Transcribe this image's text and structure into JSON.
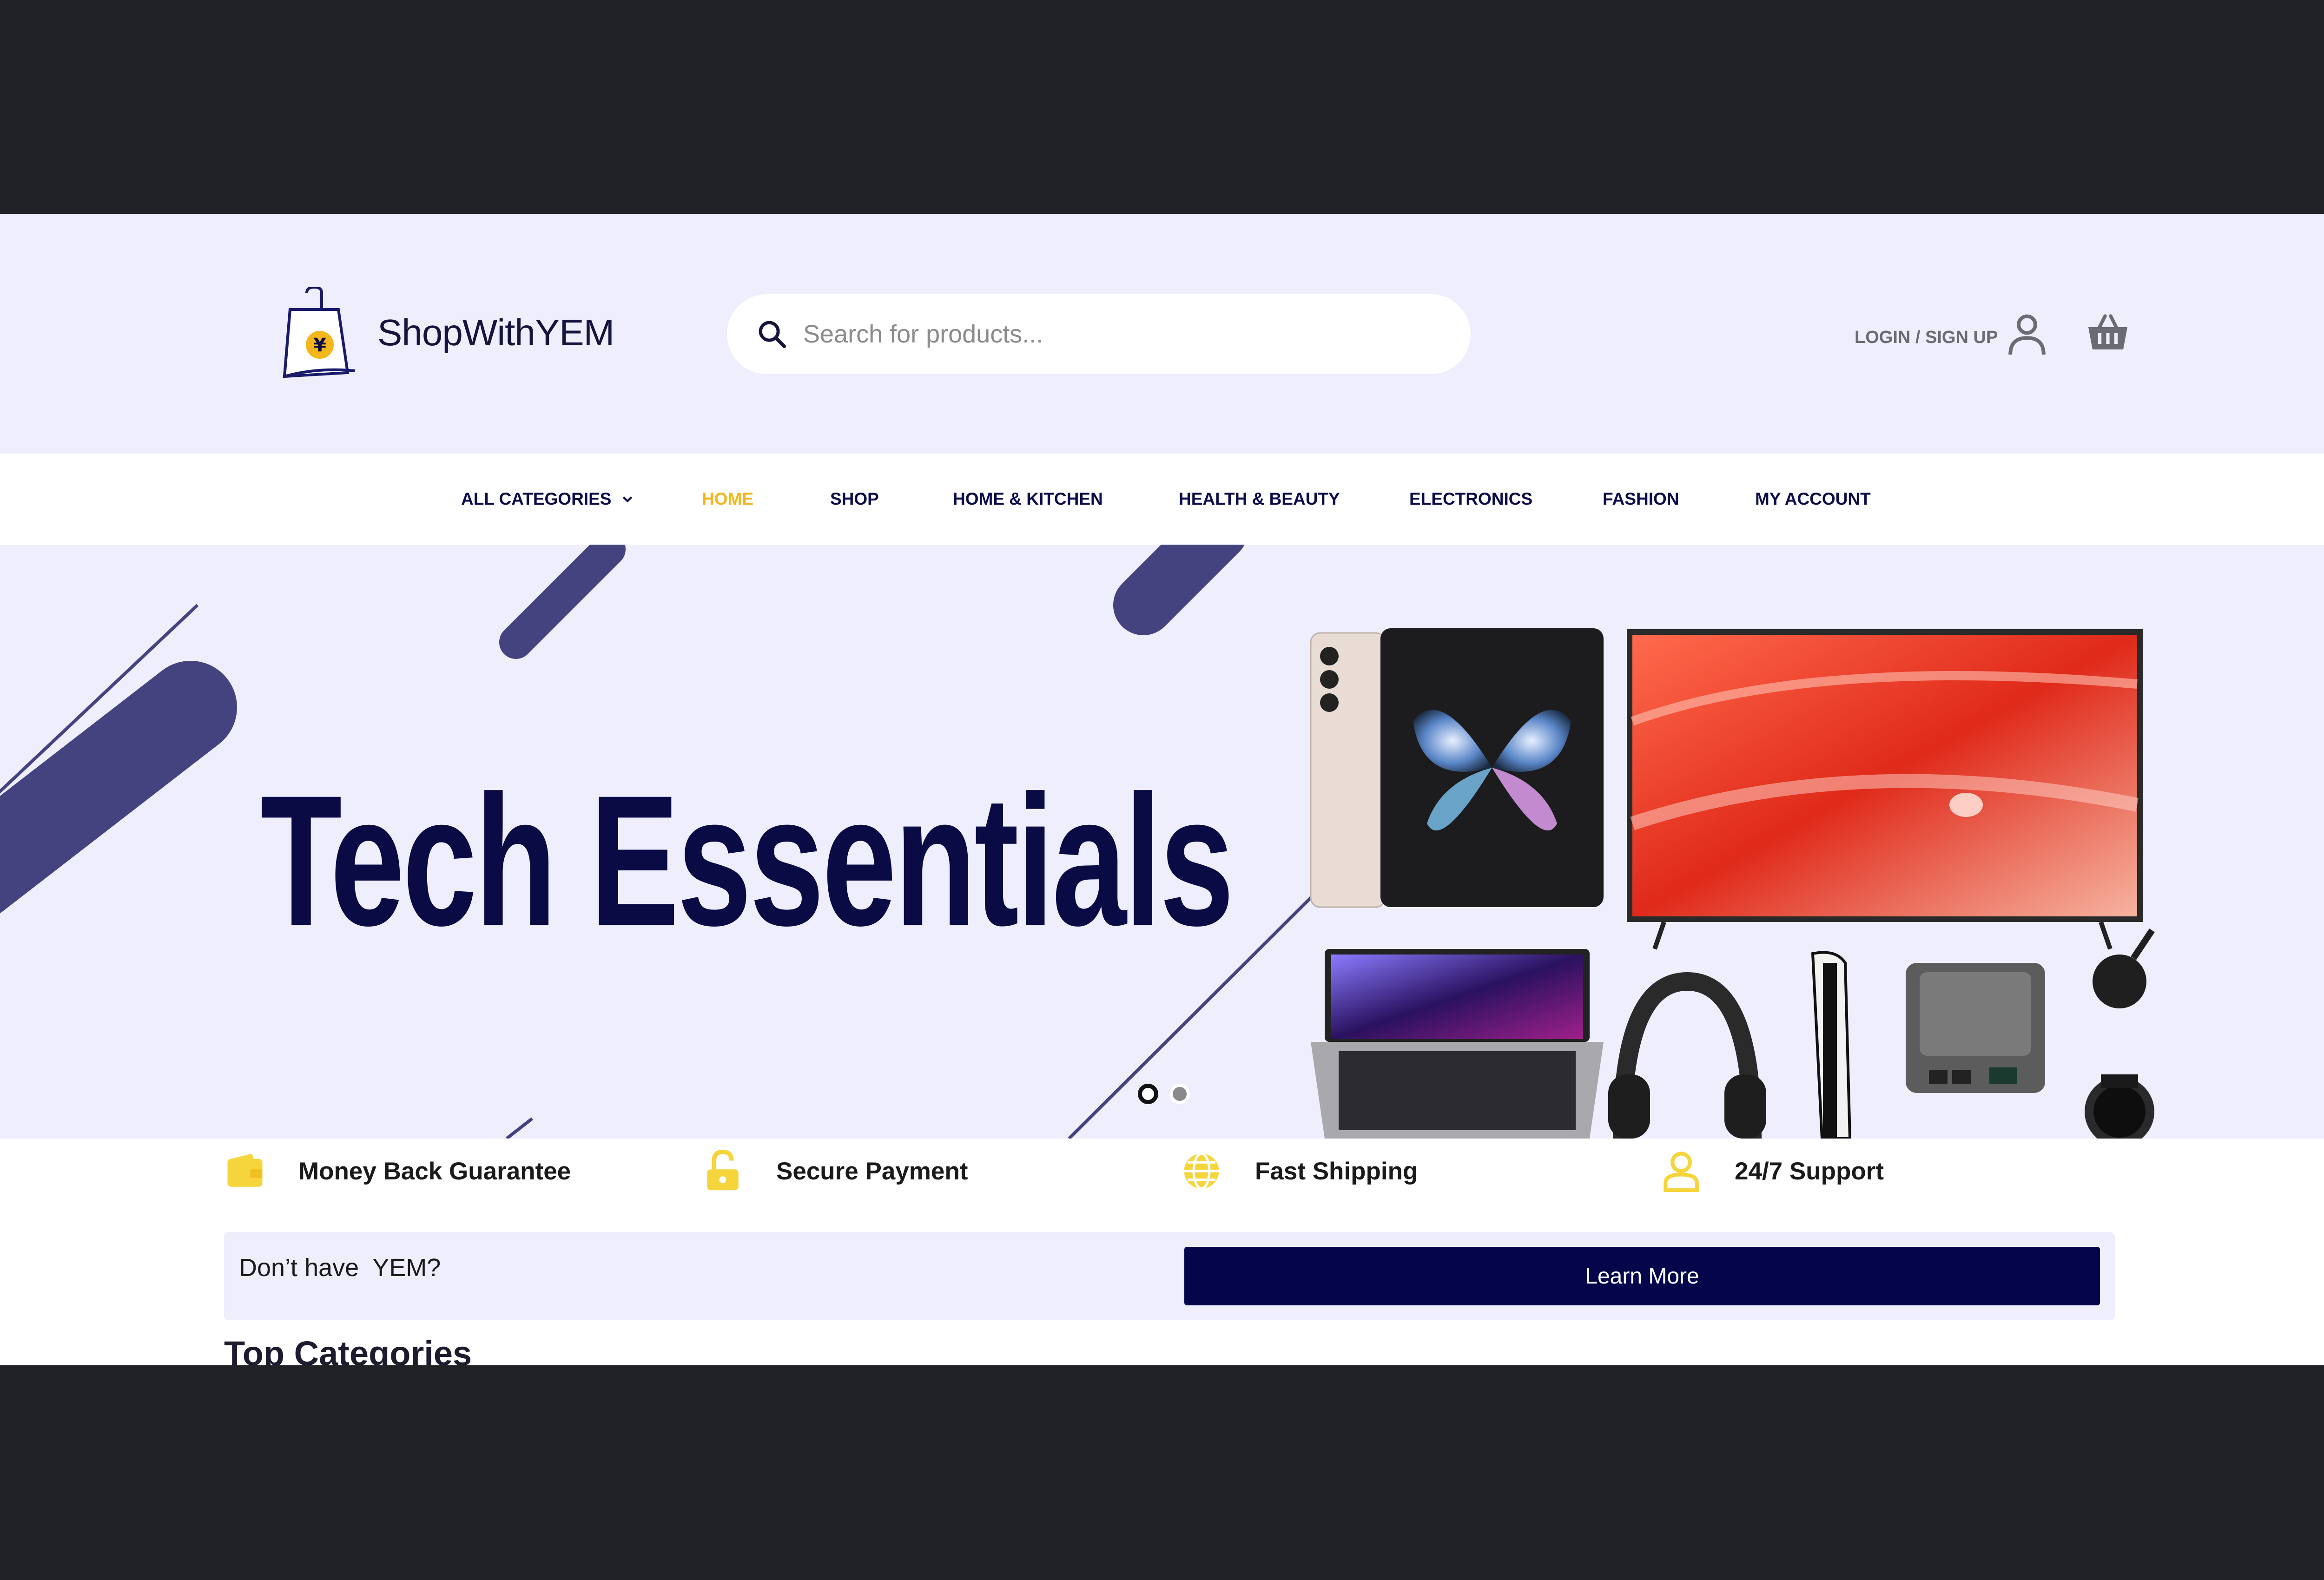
{
  "brand": {
    "name": "ShopWithYEM",
    "logo_symbol": "¥"
  },
  "search": {
    "placeholder": "Search for products..."
  },
  "account": {
    "login_label": "LOGIN / SIGN UP"
  },
  "nav": {
    "items": [
      {
        "label": "ALL CATEGORIES",
        "active": false
      },
      {
        "label": "HOME",
        "active": true
      },
      {
        "label": "SHOP",
        "active": false
      },
      {
        "label": "HOME & KITCHEN",
        "active": false
      },
      {
        "label": "HEALTH & BEAUTY",
        "active": false
      },
      {
        "label": "ELECTRONICS",
        "active": false
      },
      {
        "label": "FASHION",
        "active": false
      },
      {
        "label": "MY ACCOUNT",
        "active": false
      }
    ]
  },
  "hero": {
    "title": "Tech Essentials",
    "slides_total": 2,
    "active_slide": 1
  },
  "features": [
    {
      "label": "Money Back Guarantee",
      "icon": "wallet-icon"
    },
    {
      "label": "Secure Payment",
      "icon": "unlock-icon"
    },
    {
      "label": "Fast Shipping",
      "icon": "globe-icon"
    },
    {
      "label": "24/7 Support",
      "icon": "user-support-icon"
    }
  ],
  "promo": {
    "text": "Don’t have  YEM?",
    "button_label": "Learn More"
  },
  "section": {
    "title": "Top Categories"
  },
  "colors": {
    "header_bg": "#efeefd",
    "navy": "#05054c",
    "accent_yellow": "#f3b61b",
    "page_bg": "#202124"
  }
}
